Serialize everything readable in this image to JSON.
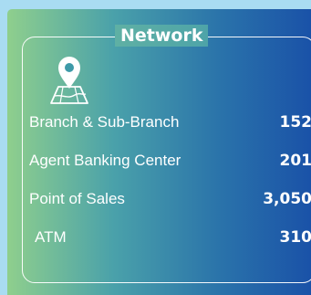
{
  "card": {
    "title": "Network",
    "icon": "map-location-pin-icon",
    "items": [
      {
        "label": "Branch & Sub-Branch",
        "value": "152"
      },
      {
        "label": "Agent Banking Center",
        "value": "201"
      },
      {
        "label": "Point of Sales",
        "value": "3,050"
      },
      {
        "label": "ATM",
        "value": "310"
      }
    ]
  },
  "colors": {
    "gradient_start": "#8fcf8d",
    "gradient_end": "#1a52a8",
    "page_background": "#a9dcf2",
    "text": "#ffffff"
  }
}
